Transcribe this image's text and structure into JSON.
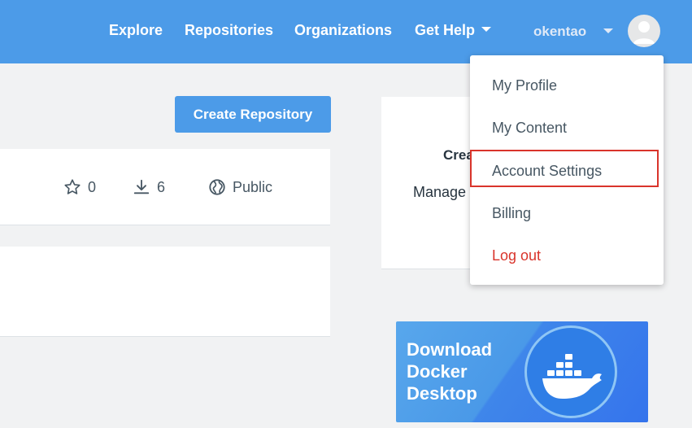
{
  "nav": {
    "links": [
      "Explore",
      "Repositories",
      "Organizations",
      "Get Help"
    ],
    "username": "okentao"
  },
  "main": {
    "create_button": "Create Repository",
    "repo_stats": {
      "stars": "0",
      "downloads": "6",
      "visibility": "Public"
    }
  },
  "sidebar": {
    "title_fragment": "Crea",
    "text_fragment": "Manage"
  },
  "dropdown": {
    "items": [
      "My Profile",
      "My Content",
      "Account Settings",
      "Billing",
      "Log out"
    ],
    "logout_color": "#d9342b",
    "highlighted": "Account Settings"
  },
  "promo": {
    "lines": [
      "Download",
      "Docker",
      "Desktop"
    ]
  },
  "colors": {
    "topbar": "#4c9be8",
    "accent": "#4c9be8"
  }
}
